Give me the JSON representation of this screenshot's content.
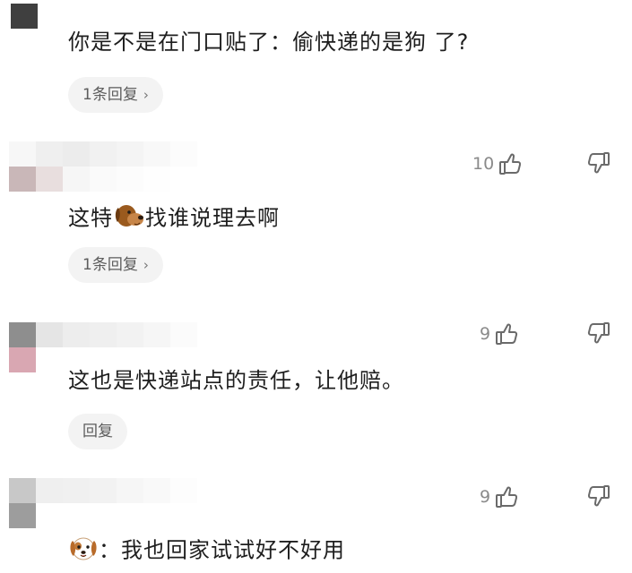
{
  "comments": [
    {
      "text": "你是不是在门口贴了：偷快递的是狗 了?",
      "reply_label": "1条回复",
      "likes": null
    },
    {
      "text_before": "这特",
      "text_after": "找谁说理去啊",
      "emoji": "dog-face-emoji",
      "reply_label": "1条回复",
      "likes": "10"
    },
    {
      "text": "这也是快递站点的责任，让他赔。",
      "reply_label": "回复",
      "likes": "9"
    },
    {
      "text_after": "：我也回家试试好不好用",
      "emoji": "puppy-face-emoji",
      "likes": "9"
    }
  ],
  "icons": {
    "like": "thumbs-up-icon",
    "dislike": "thumbs-down-icon",
    "chevron": "chevron-right-icon"
  },
  "colors": {
    "text": "#1e1e1e",
    "muted": "#8a8a8a",
    "pill_bg": "#f3f3f3"
  }
}
